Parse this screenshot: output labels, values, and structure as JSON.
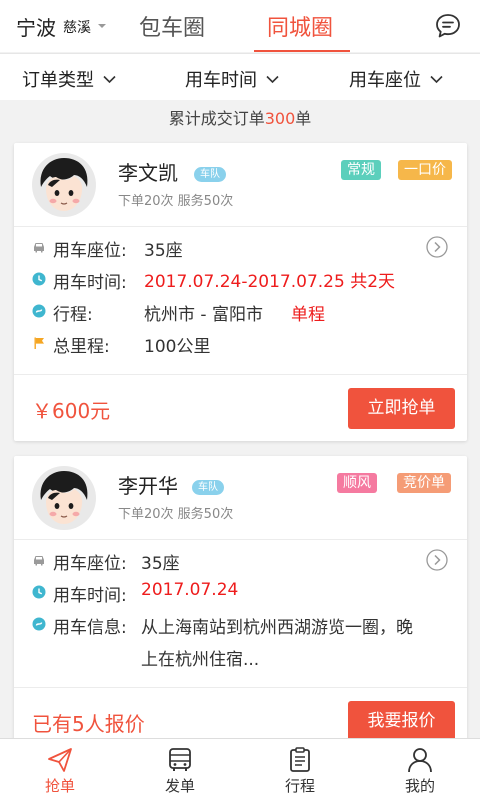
{
  "header": {
    "city": "宁波",
    "district": "慈溪",
    "tabs": [
      {
        "label": "包车圈",
        "active": false
      },
      {
        "label": "同城圈",
        "active": true
      }
    ],
    "message_icon": "chat-bubble-icon"
  },
  "filters": [
    {
      "label": "订单类型"
    },
    {
      "label": "用车时间"
    },
    {
      "label": "用车座位"
    }
  ],
  "summary": {
    "prefix": "累计成交订单",
    "count": "300",
    "suffix": "单"
  },
  "orders": [
    {
      "name": "李文凯",
      "badge": "车队",
      "stats": "下单20次  服务50次",
      "tags": [
        {
          "label": "常规",
          "color": "#5ccfbc"
        },
        {
          "label": "一口价",
          "color": "#f6b74a"
        }
      ],
      "rows": [
        {
          "icon": "car-icon",
          "label": "用车座位:",
          "value": "35座"
        },
        {
          "icon": "clock-icon",
          "label": "用车时间:",
          "value": "2017.07.24-2017.07.25 共2天"
        },
        {
          "icon": "route-icon",
          "label": "行程:",
          "value": "杭州市 - 富阳市",
          "extra": "单程"
        },
        {
          "icon": "flag-icon",
          "label": "总里程:",
          "value": "100公里"
        }
      ],
      "price": "￥600元",
      "action": "立即抢单"
    },
    {
      "name": "李开华",
      "badge": "车队",
      "stats": "下单20次  服务50次",
      "tags": [
        {
          "label": "顺风",
          "color": "#f57aa0"
        },
        {
          "label": "竞价单",
          "color": "#f59c76"
        }
      ],
      "rows": [
        {
          "icon": "car-icon",
          "label": "用车座位:",
          "value": "35座"
        },
        {
          "icon": "clock-icon",
          "label": "用车时间:",
          "value": "2017.07.24"
        },
        {
          "icon": "route-icon",
          "label": "用车信息:",
          "value_line1": "从上海南站到杭州西湖游览一圈，晚",
          "value_line2": "上在杭州住宿..."
        }
      ],
      "price": "已有5人报价",
      "action": "我要报价"
    }
  ],
  "bottom_nav": [
    {
      "label": "抢单",
      "icon": "paper-plane-icon",
      "active": true
    },
    {
      "label": "发单",
      "icon": "bus-icon",
      "active": false
    },
    {
      "label": "行程",
      "icon": "clipboard-icon",
      "active": false
    },
    {
      "label": "我的",
      "icon": "person-icon",
      "active": false
    }
  ],
  "colors": {
    "accent": "#f0533d",
    "time_red": "#ee1c1c",
    "badge_blue": "#8ad1ec"
  }
}
